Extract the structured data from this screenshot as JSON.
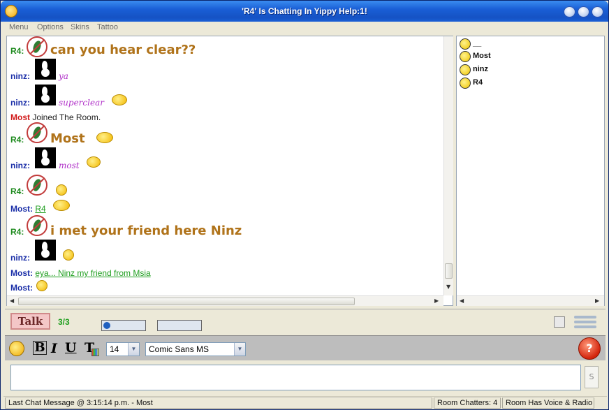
{
  "window": {
    "title": "'R4' Is Chatting In Yippy Help:1!"
  },
  "menu": [
    "Menu",
    "Options",
    "Skins",
    "Tattoo"
  ],
  "messages": [
    {
      "user": "R4:",
      "text": "can you hear clear??"
    },
    {
      "user": "ninz:",
      "text": "ya"
    },
    {
      "user": "ninz:",
      "text": "superclear"
    },
    {
      "user": "Most",
      "text": "Joined The Room."
    },
    {
      "user": "R4:",
      "text": "Most"
    },
    {
      "user": "ninz:",
      "text": "most"
    },
    {
      "user": "R4:",
      "text": ""
    },
    {
      "user": "Most:",
      "text": "R4"
    },
    {
      "user": "R4:",
      "text": "i met your friend here Ninz"
    },
    {
      "user": "ninz:",
      "text": ""
    },
    {
      "user": "Most:",
      "text": "eya... Ninz my friend from Msia"
    },
    {
      "user": "Most:",
      "text": ""
    }
  ],
  "users": [
    "__",
    "Most",
    "ninz",
    "R4"
  ],
  "talk": {
    "label": "Talk",
    "count": "3/3"
  },
  "format": {
    "bold": "B",
    "italic": "I",
    "underline": "U",
    "color": "T",
    "font_size": "14",
    "font_name": "Comic Sans MS"
  },
  "input": {
    "send_label": "S",
    "value": ""
  },
  "status": {
    "last_message": "Last Chat Message @ 3:15:14 p.m. - Most",
    "room_chatters": "Room Chatters: 4",
    "voice": "Room Has Voice & Radio"
  },
  "colors": {
    "green_user": "#1d8a1d",
    "blue_user": "#1b2fa8",
    "red_user": "#d11b1b",
    "brown_text": "#b0731a",
    "purple_text": "#b133c9",
    "link_green": "#1e9e1e"
  }
}
